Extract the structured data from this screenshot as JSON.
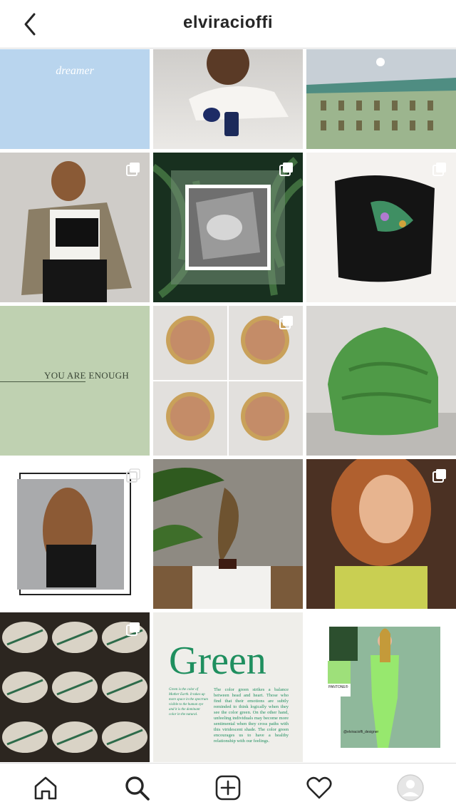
{
  "header": {
    "username": "elviracioffi"
  },
  "posts": [
    {
      "caption": "dreamer"
    },
    {
      "caption": ""
    },
    {
      "caption": ""
    },
    {
      "caption": ""
    },
    {
      "caption": ""
    },
    {
      "caption": ""
    },
    {
      "caption": "YOU ARE ENOUGH"
    },
    {
      "caption": ""
    },
    {
      "caption": ""
    },
    {
      "caption": ""
    },
    {
      "caption": ""
    },
    {
      "caption": ""
    },
    {
      "caption": ""
    },
    {
      "caption": "Green",
      "body_left": "Green is the color of Mother Earth. It takes up more space in the spectrum visible to the human eye and it is the dominant color in the natural.",
      "body_right": "The color green strikes a balance between head and heart. Those who find that their emotions are subtly reminded to think logically when they see the color green. On the other hand, unfeeling individuals may become more sentimental when they cross paths with this viridescent shade. The color green encourages us to have a healthy relationship with our feelings."
    },
    {
      "caption": "",
      "pantone_label": "PANTONE®",
      "handle": "@elviracioffi_designer"
    }
  ],
  "tabs": [
    {
      "icon": "home-icon"
    },
    {
      "icon": "search-icon"
    },
    {
      "icon": "add-post-icon"
    },
    {
      "icon": "heart-icon"
    },
    {
      "icon": "profile-avatar"
    }
  ],
  "colors": {
    "accent_green": "#1f8f5f",
    "border": "#dbdbdb",
    "text": "#262626"
  }
}
